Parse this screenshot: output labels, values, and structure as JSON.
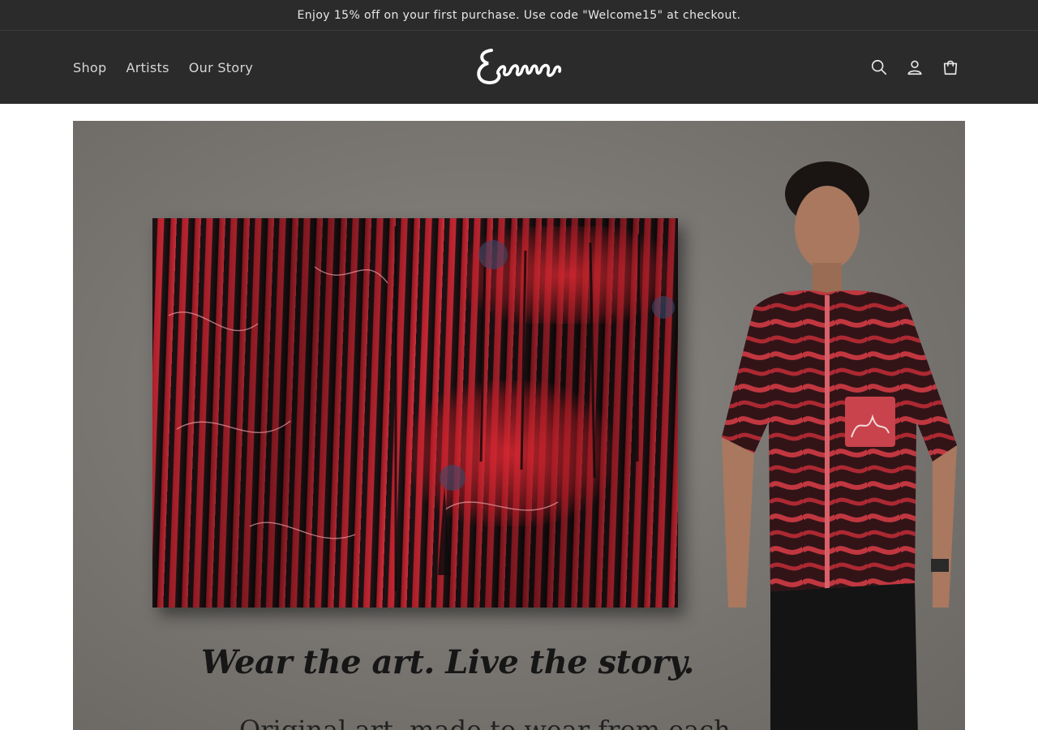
{
  "announcement": {
    "text": "Enjoy 15% off on your first purchase. Use code \"Welcome15\" at checkout."
  },
  "nav": {
    "items": [
      {
        "label": "Shop"
      },
      {
        "label": "Artists"
      },
      {
        "label": "Our Story"
      }
    ]
  },
  "brand": {
    "logo_text": "Seemeeo"
  },
  "header_icons": [
    "search-icon",
    "account-icon",
    "cart-icon"
  ],
  "hero": {
    "tagline": "Wear the art. Live the story.",
    "subline": "Original art, made to wear from each"
  },
  "colors": {
    "header_bg": "#2b2b2b",
    "nav_text": "#d6d6d6",
    "hero_bg": "#7b7874",
    "accent_red": "#c52a35"
  }
}
